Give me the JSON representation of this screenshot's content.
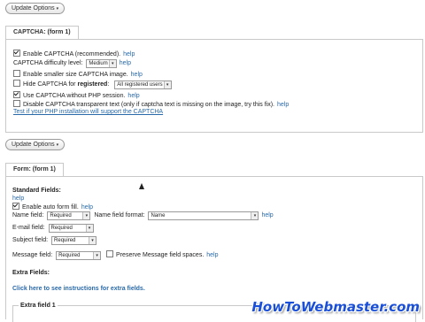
{
  "buttons": {
    "update_options": "Update Options",
    "update_options_2": "Update Options"
  },
  "captcha": {
    "tab": "CAPTCHA: (form 1)",
    "enable": "Enable CAPTCHA (recommended).",
    "difficulty_label": "CAPTCHA difficulty level:",
    "difficulty_value": "Medium",
    "smaller": "Enable smaller size CAPTCHA image.",
    "hide": "Hide CAPTCHA for",
    "hide_bold": "registered",
    "hide_sel": "All registered users",
    "without_session": "Use CAPTCHA without PHP session.",
    "transparent": "Disable CAPTCHA transparent text (only if captcha text is missing on the image, try this fix).",
    "test_link": "Test if your PHP installation will support the CAPTCHA"
  },
  "help": "help",
  "form": {
    "tab": "Form: (form 1)",
    "standard_fields": "Standard Fields:",
    "help_label": "help",
    "autofill": "Enable auto form fill.",
    "name_field": "Name field:",
    "name_field_value": "Required",
    "name_format": "Name field format:",
    "name_format_value": "Name",
    "email_field": "E-mail field:",
    "email_field_value": "Required",
    "subject_field": "Subject field:",
    "subject_field_value": "Required",
    "message_field": "Message field:",
    "message_field_value": "Required",
    "preserve": "Preserve Message field spaces.",
    "extra_fields": "Extra Fields:",
    "extra_link": "Click here to see instructions for extra fields.",
    "extra_field_1": "Extra field 1"
  },
  "watermark": "HowToWebmaster.com",
  "colors": {
    "link": "#2a6aa8",
    "watermark": "#1a4fd6"
  }
}
